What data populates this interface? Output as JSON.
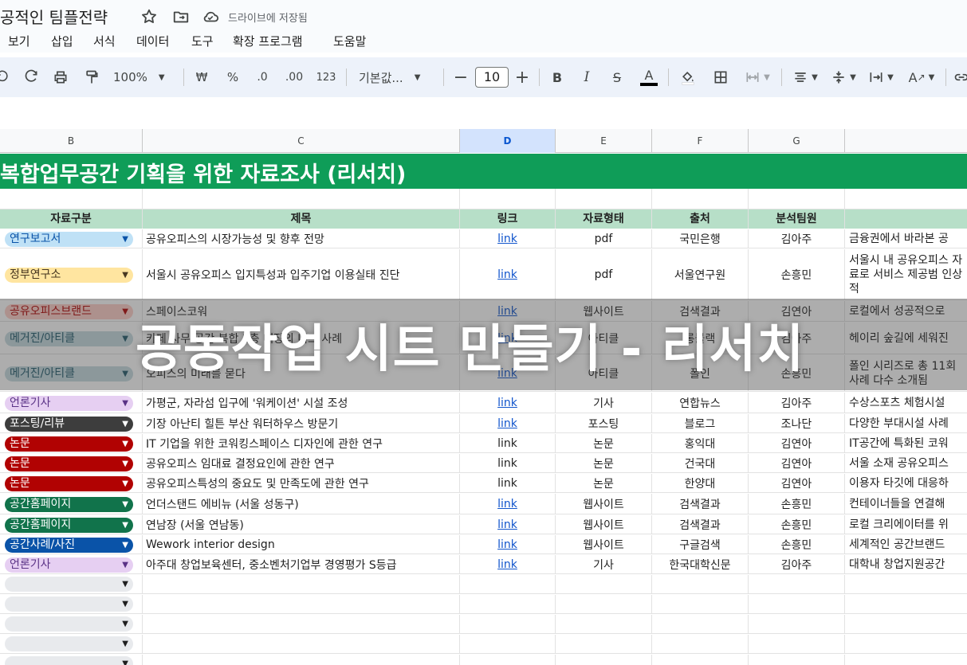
{
  "doc": {
    "title": "공적인 팀플전략",
    "drive_status": "드라이브에 저장됨"
  },
  "menu": [
    "보기",
    "삽입",
    "서식",
    "데이터",
    "도구",
    "확장 프로그램",
    "도움말"
  ],
  "toolbar": {
    "zoom": "100%",
    "currency": "₩",
    "percent": "%",
    "dec_decrease": ".0",
    "dec_increase": ".00",
    "number_format": "123",
    "font": "기본값...",
    "font_size": "10",
    "bold": "B",
    "italic": "I",
    "strike": "S",
    "text_color": "A"
  },
  "columns": [
    "B",
    "C",
    "D",
    "E",
    "F",
    "G"
  ],
  "selected_column": "D",
  "banner": "복합업무공간 기획을 위한 자료조사 (리서치)",
  "headers": [
    "자료구분",
    "제목",
    "링크",
    "자료형태",
    "출처",
    "분석팀원"
  ],
  "rows": [
    {
      "category": "연구보고서",
      "chip_bg": "#bfe1f6",
      "chip_fg": "#0a53a8",
      "title": "공유오피스의 시장가능성 및 향후 전망",
      "link": "link",
      "link_style": "hyper",
      "type": "pdf",
      "source": "국민은행",
      "member": "김아주",
      "desc": "금융권에서 바라본 공"
    },
    {
      "category": "정부연구소",
      "chip_bg": "#ffe5a0",
      "chip_fg": "#473821",
      "title": "서울시 공유오피스 입지특성과 입주기업 이용실태 진단",
      "link": "link",
      "link_style": "hyper",
      "type": "pdf",
      "source": "서울연구원",
      "member": "손흥민",
      "desc": "서울시 내 공유오피스 자료로 서비스 제공범 인상적"
    },
    {
      "category": "공유오피스브랜드",
      "chip_bg": "#ffcfc9",
      "chip_fg": "#b10202",
      "title": "스페이스코워",
      "link": "link",
      "link_style": "hyper",
      "type": "웹사이트",
      "source": "검색결과",
      "member": "김연아",
      "desc": "로컬에서 성공적으로"
    },
    {
      "category": "메거진/아티클",
      "chip_bg": "#c6dbe1",
      "chip_fg": "#215a6c",
      "title": "카페 사무 공간 복합 1층 매장의 니즈 사례",
      "link": "link",
      "link_style": "hyper",
      "type": "아티클",
      "source": "롱블랙",
      "member": "김아주",
      "desc": "헤이리 숲길에 세워진"
    },
    {
      "category": "메거진/아티클",
      "chip_bg": "#c6dbe1",
      "chip_fg": "#215a6c",
      "title": "오피스의 미래를 묻다",
      "link": "link",
      "link_style": "hyper",
      "type": "아티클",
      "source": "폴인",
      "member": "손흥민",
      "desc": "폴인 시리즈로 총 11회 사례 다수 소개됨"
    },
    {
      "category": "언론기사",
      "chip_bg": "#e6cff2",
      "chip_fg": "#5a3286",
      "title": "가평군, 자라섬 입구에 '워케이션' 시설 조성",
      "link": "link",
      "link_style": "hyper",
      "type": "기사",
      "source": "연합뉴스",
      "member": "김아주",
      "desc": "수상스포츠 체험시설"
    },
    {
      "category": "포스팅/리뷰",
      "chip_bg": "#3d3d3d",
      "chip_fg": "#ffffff",
      "title": "기장 아난티 힐튼 부산 워터하우스 방문기",
      "link": "link",
      "link_style": "hyper",
      "type": "포스팅",
      "source": "블로그",
      "member": "조나단",
      "desc": "다양한 부대시설 사례"
    },
    {
      "category": "논문",
      "chip_bg": "#b10202",
      "chip_fg": "#ffffff",
      "title": "IT 기업을 위한 코워킹스페이스 디자인에 관한 연구",
      "link": "link",
      "link_style": "plain",
      "type": "논문",
      "source": "홍익대",
      "member": "김연아",
      "desc": "IT공간에 특화된 코워"
    },
    {
      "category": "논문",
      "chip_bg": "#b10202",
      "chip_fg": "#ffffff",
      "title": "공유오피스 임대료 결정요인에 관한 연구",
      "link": "link",
      "link_style": "plain",
      "type": "논문",
      "source": "건국대",
      "member": "김연아",
      "desc": "서울 소재 공유오피스"
    },
    {
      "category": "논문",
      "chip_bg": "#b10202",
      "chip_fg": "#ffffff",
      "title": "공유오피스특성의 중요도 및 만족도에 관한 연구",
      "link": "link",
      "link_style": "plain",
      "type": "논문",
      "source": "한양대",
      "member": "김연아",
      "desc": "이용자 타깃에 대응하"
    },
    {
      "category": "공간홈페이지",
      "chip_bg": "#11734b",
      "chip_fg": "#ffffff",
      "title": "언더스탠드 에비뉴 (서울 성동구)",
      "link": "link",
      "link_style": "hyper",
      "type": "웹사이트",
      "source": "검색결과",
      "member": "손흥민",
      "desc": "컨테이너들을 연결해"
    },
    {
      "category": "공간홈페이지",
      "chip_bg": "#11734b",
      "chip_fg": "#ffffff",
      "title": "연남장 (서울 연남동)",
      "link": "link",
      "link_style": "hyper",
      "type": "웹사이트",
      "source": "검색결과",
      "member": "손흥민",
      "desc": "로컬 크리에이터를 위"
    },
    {
      "category": "공간사례/사진",
      "chip_bg": "#0a53a8",
      "chip_fg": "#ffffff",
      "title": "Wework interior design",
      "link": "link",
      "link_style": "hyper",
      "type": "웹사이트",
      "source": "구글검색",
      "member": "손흥민",
      "desc": "세계적인 공간브랜드"
    },
    {
      "category": "언론기사",
      "chip_bg": "#e6cff2",
      "chip_fg": "#5a3286",
      "title": "아주대 창업보육센터, 중소벤처기업부 경영평가 S등급",
      "link": "link",
      "link_style": "hyper",
      "type": "기사",
      "source": "한국대학신문",
      "member": "김아주",
      "desc": "대학내 창업지원공간"
    }
  ],
  "empty_rows": 5,
  "overlay_text": "공동작업 시트 만들기 - 리서치",
  "colors": {
    "banner": "#0f9d58",
    "header_row": "#b7dfc8",
    "selected_column": "#d3e3fd",
    "link": "#1155cc"
  },
  "icons": [
    "star-icon",
    "move-to-folder-icon",
    "cloud-saved-icon",
    "undo-icon",
    "redo-icon",
    "print-icon",
    "paint-format-icon",
    "fill-color-icon",
    "borders-icon",
    "merge-cells-icon",
    "align-horizontal-icon",
    "align-vertical-icon",
    "text-wrap-icon",
    "text-rotate-icon",
    "link-icon"
  ]
}
